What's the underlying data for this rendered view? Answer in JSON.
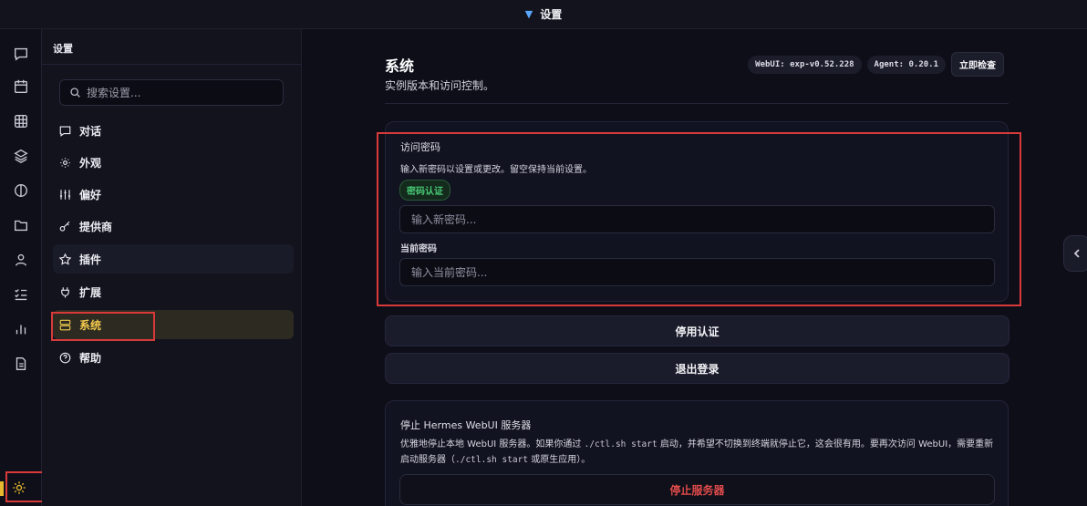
{
  "header": {
    "title": "设置"
  },
  "sidebar": {
    "title": "设置",
    "search_placeholder": "搜索设置...",
    "items": [
      {
        "label": "对话",
        "icon": "message-icon"
      },
      {
        "label": "外观",
        "icon": "sun-icon"
      },
      {
        "label": "偏好",
        "icon": "sliders-icon"
      },
      {
        "label": "提供商",
        "icon": "key-icon"
      },
      {
        "label": "插件",
        "icon": "star-icon"
      },
      {
        "label": "扩展",
        "icon": "plug-icon"
      },
      {
        "label": "系统",
        "icon": "server-icon"
      },
      {
        "label": "帮助",
        "icon": "help-icon"
      }
    ]
  },
  "main": {
    "title": "系统",
    "subtitle": "实例版本和访问控制。",
    "webui_version": "WebUI: exp-v0.52.228",
    "agent_version": "Agent: 0.20.1",
    "check_button": "立即检查",
    "access": {
      "label": "访问密码",
      "hint": "输入新密码以设置或更改。留空保持当前设置。",
      "badge": "密码认证",
      "new_placeholder": "输入新密码...",
      "current_label": "当前密码",
      "current_placeholder": "输入当前密码..."
    },
    "disable_auth": "停用认证",
    "logout": "退出登录",
    "stop": {
      "title": "停止 Hermes WebUI 服务器",
      "desc_1": "优雅地停止本地 WebUI 服务器。如果你通过",
      "desc_code_1": "./ctl.sh start",
      "desc_2": "启动，并希望不切换到终端就停止它，这会很有用。要再次访问 WebUI，需要重新启动服务器（",
      "desc_code_2": "./ctl.sh start",
      "desc_3": "或原生应用）。",
      "button": "停止服务器"
    }
  }
}
